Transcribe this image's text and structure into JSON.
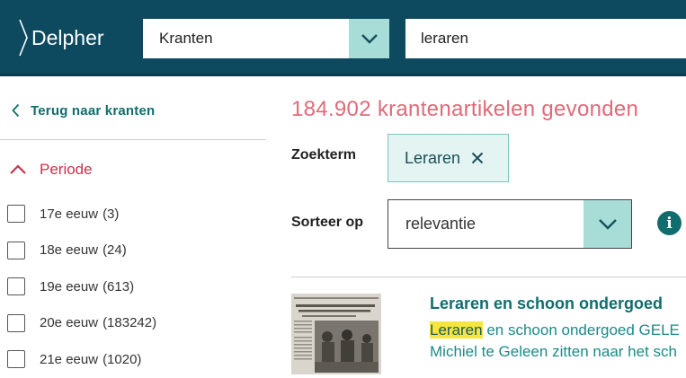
{
  "header": {
    "logo_text": "Delpher",
    "collection": "Kranten",
    "search_value": "leraren"
  },
  "sidebar": {
    "back_link": "Terug naar kranten",
    "facet_title": "Periode",
    "items": [
      {
        "label": "17e eeuw",
        "count": "(3)"
      },
      {
        "label": "18e eeuw",
        "count": "(24)"
      },
      {
        "label": "19e eeuw",
        "count": "(613)"
      },
      {
        "label": "20e eeuw",
        "count": "(183242)"
      },
      {
        "label": "21e eeuw",
        "count": "(1020)"
      }
    ]
  },
  "main": {
    "results_count": "184.902 krantenartikelen gevonden",
    "zoekterm_label": "Zoekterm",
    "chip_label": "Leraren",
    "sort_label": "Sorteer op",
    "sort_value": "relevantie",
    "result": {
      "title": "Leraren en schoon ondergoed",
      "snippet_highlight": "Leraren",
      "snippet_rest": " en schoon ondergoed GELE",
      "snippet_line2": "Michiel te Geleen zitten naar het sch"
    }
  },
  "colors": {
    "header_bg": "#0d4a5f",
    "accent_teal": "#0f6e6d",
    "toggle_bg": "#a8dcd7",
    "results_pink": "#e06a78",
    "facet_red": "#c8324d"
  },
  "icons": {
    "dropdown": "chevron-down-icon",
    "back": "chevron-left-icon",
    "facet": "chevron-up-icon",
    "chip_remove": "close-icon",
    "info": "info-icon"
  }
}
